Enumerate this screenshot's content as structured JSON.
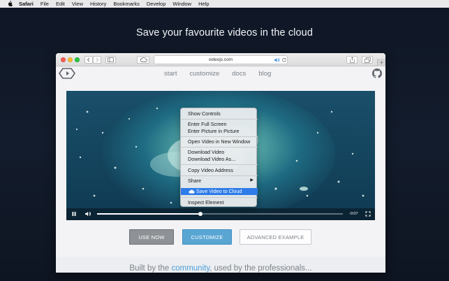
{
  "menubar": {
    "app": "Safari",
    "items": [
      "File",
      "Edit",
      "View",
      "History",
      "Bookmarks",
      "Develop",
      "Window",
      "Help"
    ]
  },
  "hero": {
    "title": "Save your favourite videos in the cloud"
  },
  "browser": {
    "url": "videojs.com",
    "newtab": "+"
  },
  "site_nav": {
    "links": [
      "start",
      "customize",
      "docs",
      "blog"
    ]
  },
  "player": {
    "time_remaining": "-0:07",
    "progress": 0.42
  },
  "context_menu": {
    "items": [
      "Show Controls",
      "Enter Full Screen",
      "Enter Picture in Picture",
      "Open Video in New Window",
      "Download Video",
      "Download Video As...",
      "Copy Video Address",
      "Share",
      "Save Video to Cloud",
      "Inspect Element"
    ],
    "highlighted": "Save Video to Cloud",
    "submenu_arrow": "▶"
  },
  "buttons": {
    "use_now": "USE NOW",
    "customize": "CUSTOMIZE",
    "advanced": "ADVANCED EXAMPLE"
  },
  "tagline": {
    "prefix": "Built by the ",
    "community": "community",
    "middle": ", used by the ",
    "professionals": "professionals..."
  },
  "colors": {
    "accent_blue": "#5aa6d3",
    "highlight": "#2e7ce9"
  }
}
